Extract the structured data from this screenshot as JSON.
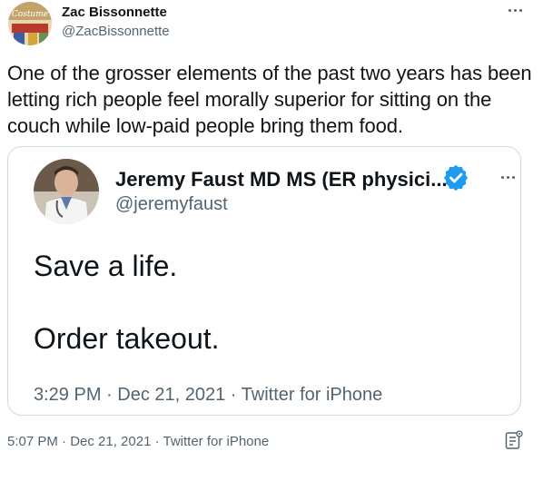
{
  "tweet": {
    "author_name": "Zac Bissonnette",
    "author_handle": "@ZacBissonnette",
    "text": "One of the grosser elements of the past two years has been letting rich people feel morally superior for sitting on the couch while low-paid people bring them food.",
    "timestamp": "5:07 PM · Dec 21, 2021 · Twitter for iPhone",
    "avatar_text": "Costume"
  },
  "quoted": {
    "author_name": "Jeremy Faust MD MS (ER physici...",
    "author_handle": "@jeremyfaust",
    "line1": "Save a life.",
    "line2": "Order takeout.",
    "timestamp": "3:29 PM · Dec 21, 2021 · Twitter for iPhone"
  },
  "icons": {
    "more": "more-icon",
    "verified": "verified-badge-icon",
    "analytics": "analytics-icon"
  },
  "colors": {
    "text": "#0f1419",
    "secondary": "#536471",
    "border": "#cfd9de",
    "verified": "#1d9bf0"
  }
}
